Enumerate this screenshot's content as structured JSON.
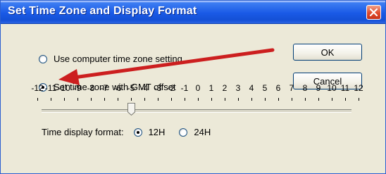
{
  "window": {
    "title": "Set Time Zone and Display Format"
  },
  "options": {
    "use_computer_tz_label": "Use computer time zone setting",
    "gmt_offset_label": "Set time zone with GMT offset",
    "selected": "gmt_offset"
  },
  "buttons": {
    "ok_label": "OK",
    "cancel_label": "Cancel"
  },
  "gmt_slider": {
    "tick_labels": [
      "-12",
      "-11",
      "-10",
      "-9",
      "-8",
      "-7",
      "-6",
      "-5",
      "-4",
      "-3",
      "-2",
      "-1",
      "0",
      "1",
      "2",
      "3",
      "4",
      "5",
      "6",
      "7",
      "8",
      "9",
      "10",
      "11",
      "12"
    ],
    "value": -5,
    "min": -12,
    "max": 12
  },
  "time_format": {
    "label": "Time display format:",
    "option_12h": "12H",
    "option_24h": "24H",
    "selected": "12H"
  },
  "colors": {
    "titlebar": "#1a5ae6",
    "dialog_bg": "#ece9d8",
    "annotation_arrow": "#cc1f1f"
  }
}
